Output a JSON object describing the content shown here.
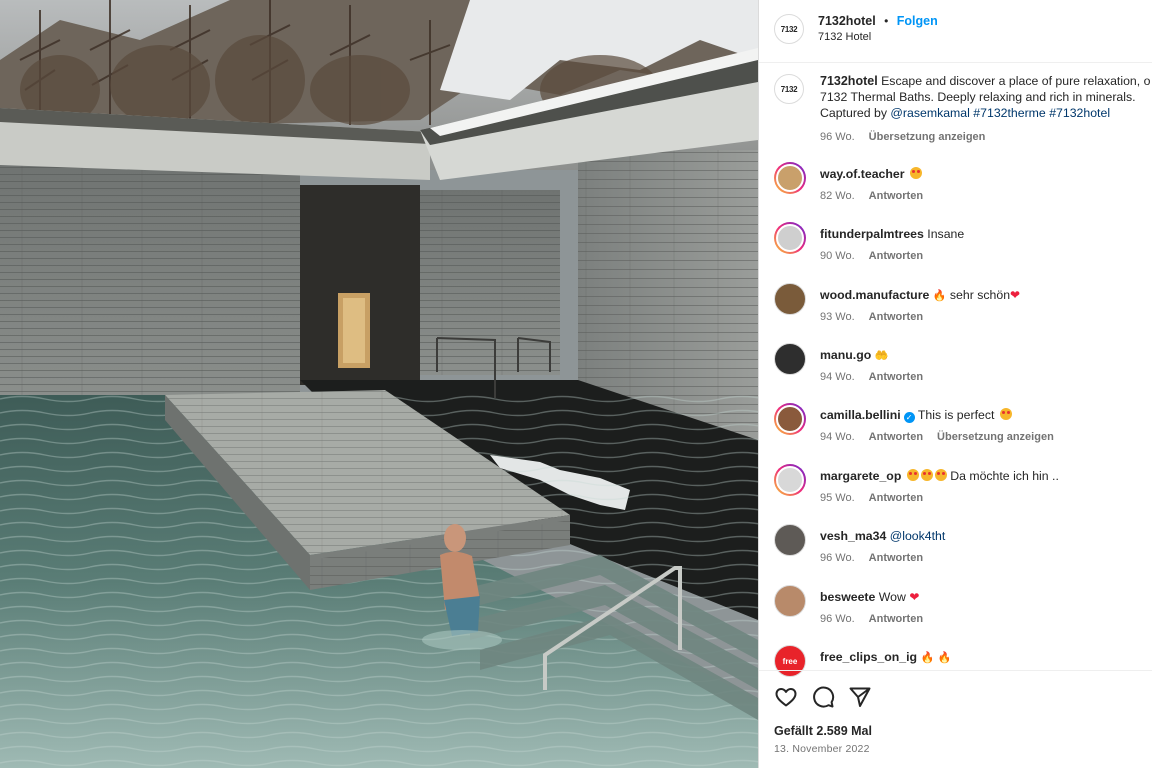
{
  "post": {
    "username": "7132hotel",
    "separator": "•",
    "follow_label": "Folgen",
    "location": "7132 Hotel",
    "logo_text": "7132"
  },
  "caption": {
    "username": "7132hotel",
    "line1": "Escape and discover a place of pure relaxation, o",
    "line2": "7132 Thermal Baths. Deeply relaxing and rich in minerals.",
    "line3_prefix": "Captured by",
    "mention": "@rasemkamal",
    "hashtag1": "#7132therme",
    "hashtag2": "#7132hotel",
    "age": "96 Wo.",
    "translate_label": "Übersetzung anzeigen"
  },
  "comments": [
    {
      "username": "way.of.teacher",
      "text": "",
      "age": "82 Wo.",
      "reply": "Antworten",
      "translate": "",
      "story_ring": true,
      "avatar_color": "#c9a06b"
    },
    {
      "username": "fitunderpalmtrees",
      "text": "Insane",
      "age": "90 Wo.",
      "reply": "Antworten",
      "translate": "",
      "story_ring": true,
      "avatar_color": "#cfcfcf"
    },
    {
      "username": "wood.manufacture",
      "text": "sehr schön",
      "age": "93 Wo.",
      "reply": "Antworten",
      "translate": "",
      "story_ring": false,
      "avatar_color": "#7a5b3a"
    },
    {
      "username": "manu.go",
      "text": "",
      "age": "94 Wo.",
      "reply": "Antworten",
      "translate": "",
      "story_ring": false,
      "avatar_color": "#2e2e2e"
    },
    {
      "username": "camilla.bellini",
      "text": "This is perfect",
      "age": "94 Wo.",
      "reply": "Antworten",
      "translate": "Übersetzung anzeigen",
      "story_ring": true,
      "avatar_color": "#8a5a3c"
    },
    {
      "username": "margarete_op",
      "text": "Da möchte ich hin ..",
      "age": "95 Wo.",
      "reply": "Antworten",
      "translate": "",
      "story_ring": true,
      "avatar_color": "#d8d8d8"
    },
    {
      "username": "vesh_ma34",
      "text": "@look4tht",
      "age": "96 Wo.",
      "reply": "Antworten",
      "translate": "",
      "story_ring": false,
      "avatar_color": "#5e5a56"
    },
    {
      "username": "besweete",
      "text": "Wow",
      "age": "96 Wo.",
      "reply": "Antworten",
      "translate": "",
      "story_ring": false,
      "avatar_color": "#b88a6a"
    },
    {
      "username": "free_clips_on_ig",
      "text": "",
      "age": "",
      "reply": "",
      "translate": "",
      "story_ring": false,
      "avatar_color": "#e8232a",
      "avatar_text": "free"
    }
  ],
  "footer": {
    "likes": "Gefällt 2.589 Mal",
    "date": "13. November 2022"
  },
  "icons": {
    "like": "heart-icon",
    "comment": "comment-icon",
    "share": "share-icon"
  },
  "colors": {
    "link": "#00376b",
    "follow": "#0095f6",
    "muted": "#737373",
    "heart": "#ed1f3d"
  }
}
